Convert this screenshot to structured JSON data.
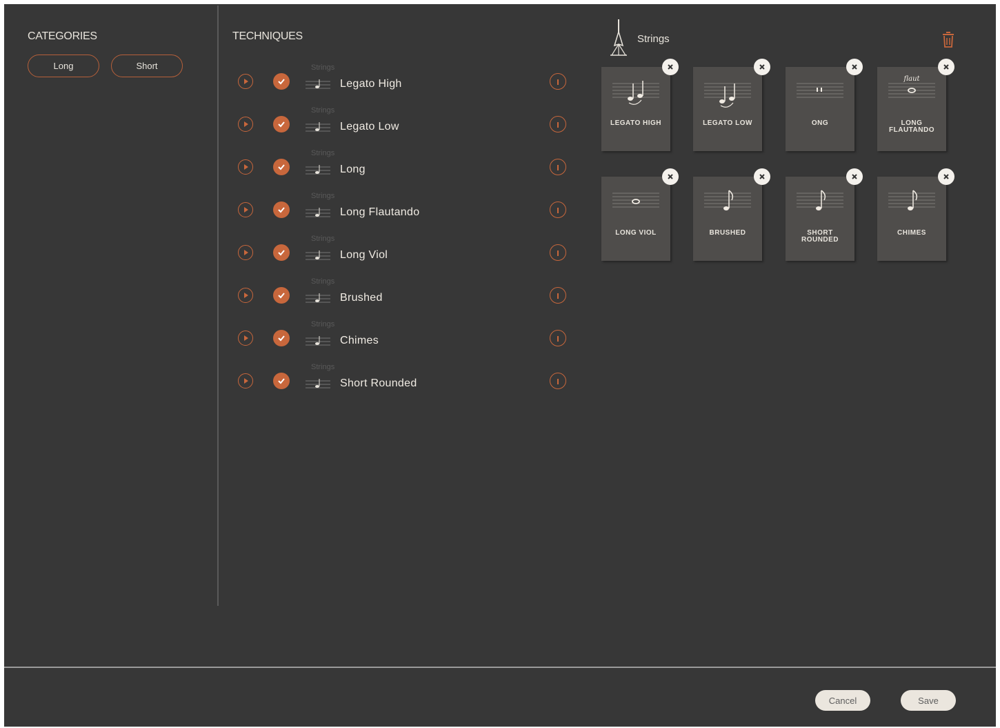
{
  "categories": {
    "title": "CATEGORIES",
    "chips": [
      "Long",
      "Short"
    ]
  },
  "techniques": {
    "title": "TECHNIQUES",
    "items": [
      {
        "sub": "Strings",
        "name": "Legato High",
        "checked": true
      },
      {
        "sub": "Strings",
        "name": "Legato Low",
        "checked": true
      },
      {
        "sub": "Strings",
        "name": "Long",
        "checked": true
      },
      {
        "sub": "Strings",
        "name": "Long Flautando",
        "checked": true
      },
      {
        "sub": "Strings",
        "name": "Long Viol",
        "checked": true
      },
      {
        "sub": "Strings",
        "name": "Brushed",
        "checked": true
      },
      {
        "sub": "Strings",
        "name": "Chimes",
        "checked": true
      },
      {
        "sub": "Strings",
        "name": "Short Rounded",
        "checked": true
      }
    ]
  },
  "selected": {
    "instrument": "Strings",
    "cards": [
      {
        "label": "LEGATO HIGH",
        "art": "two-notes"
      },
      {
        "label": "LEGATO LOW",
        "art": "two-notes-low"
      },
      {
        "label": "ONG",
        "art": "whole"
      },
      {
        "label": "LONG FLAUTANDO",
        "art": "flaut"
      },
      {
        "label": "LONG VIOL",
        "art": "whole-high"
      },
      {
        "label": "BRUSHED",
        "art": "eighth"
      },
      {
        "label": "SHORT ROUNDED",
        "art": "eighth"
      },
      {
        "label": "CHIMES",
        "art": "eighth"
      }
    ],
    "flaut_marking": "flaut"
  },
  "footer": {
    "cancel": "Cancel",
    "save": "Save"
  },
  "colors": {
    "background": "#373737",
    "accent": "#c8673c",
    "card": "#4f4d4b",
    "text": "#e8e4dc"
  }
}
